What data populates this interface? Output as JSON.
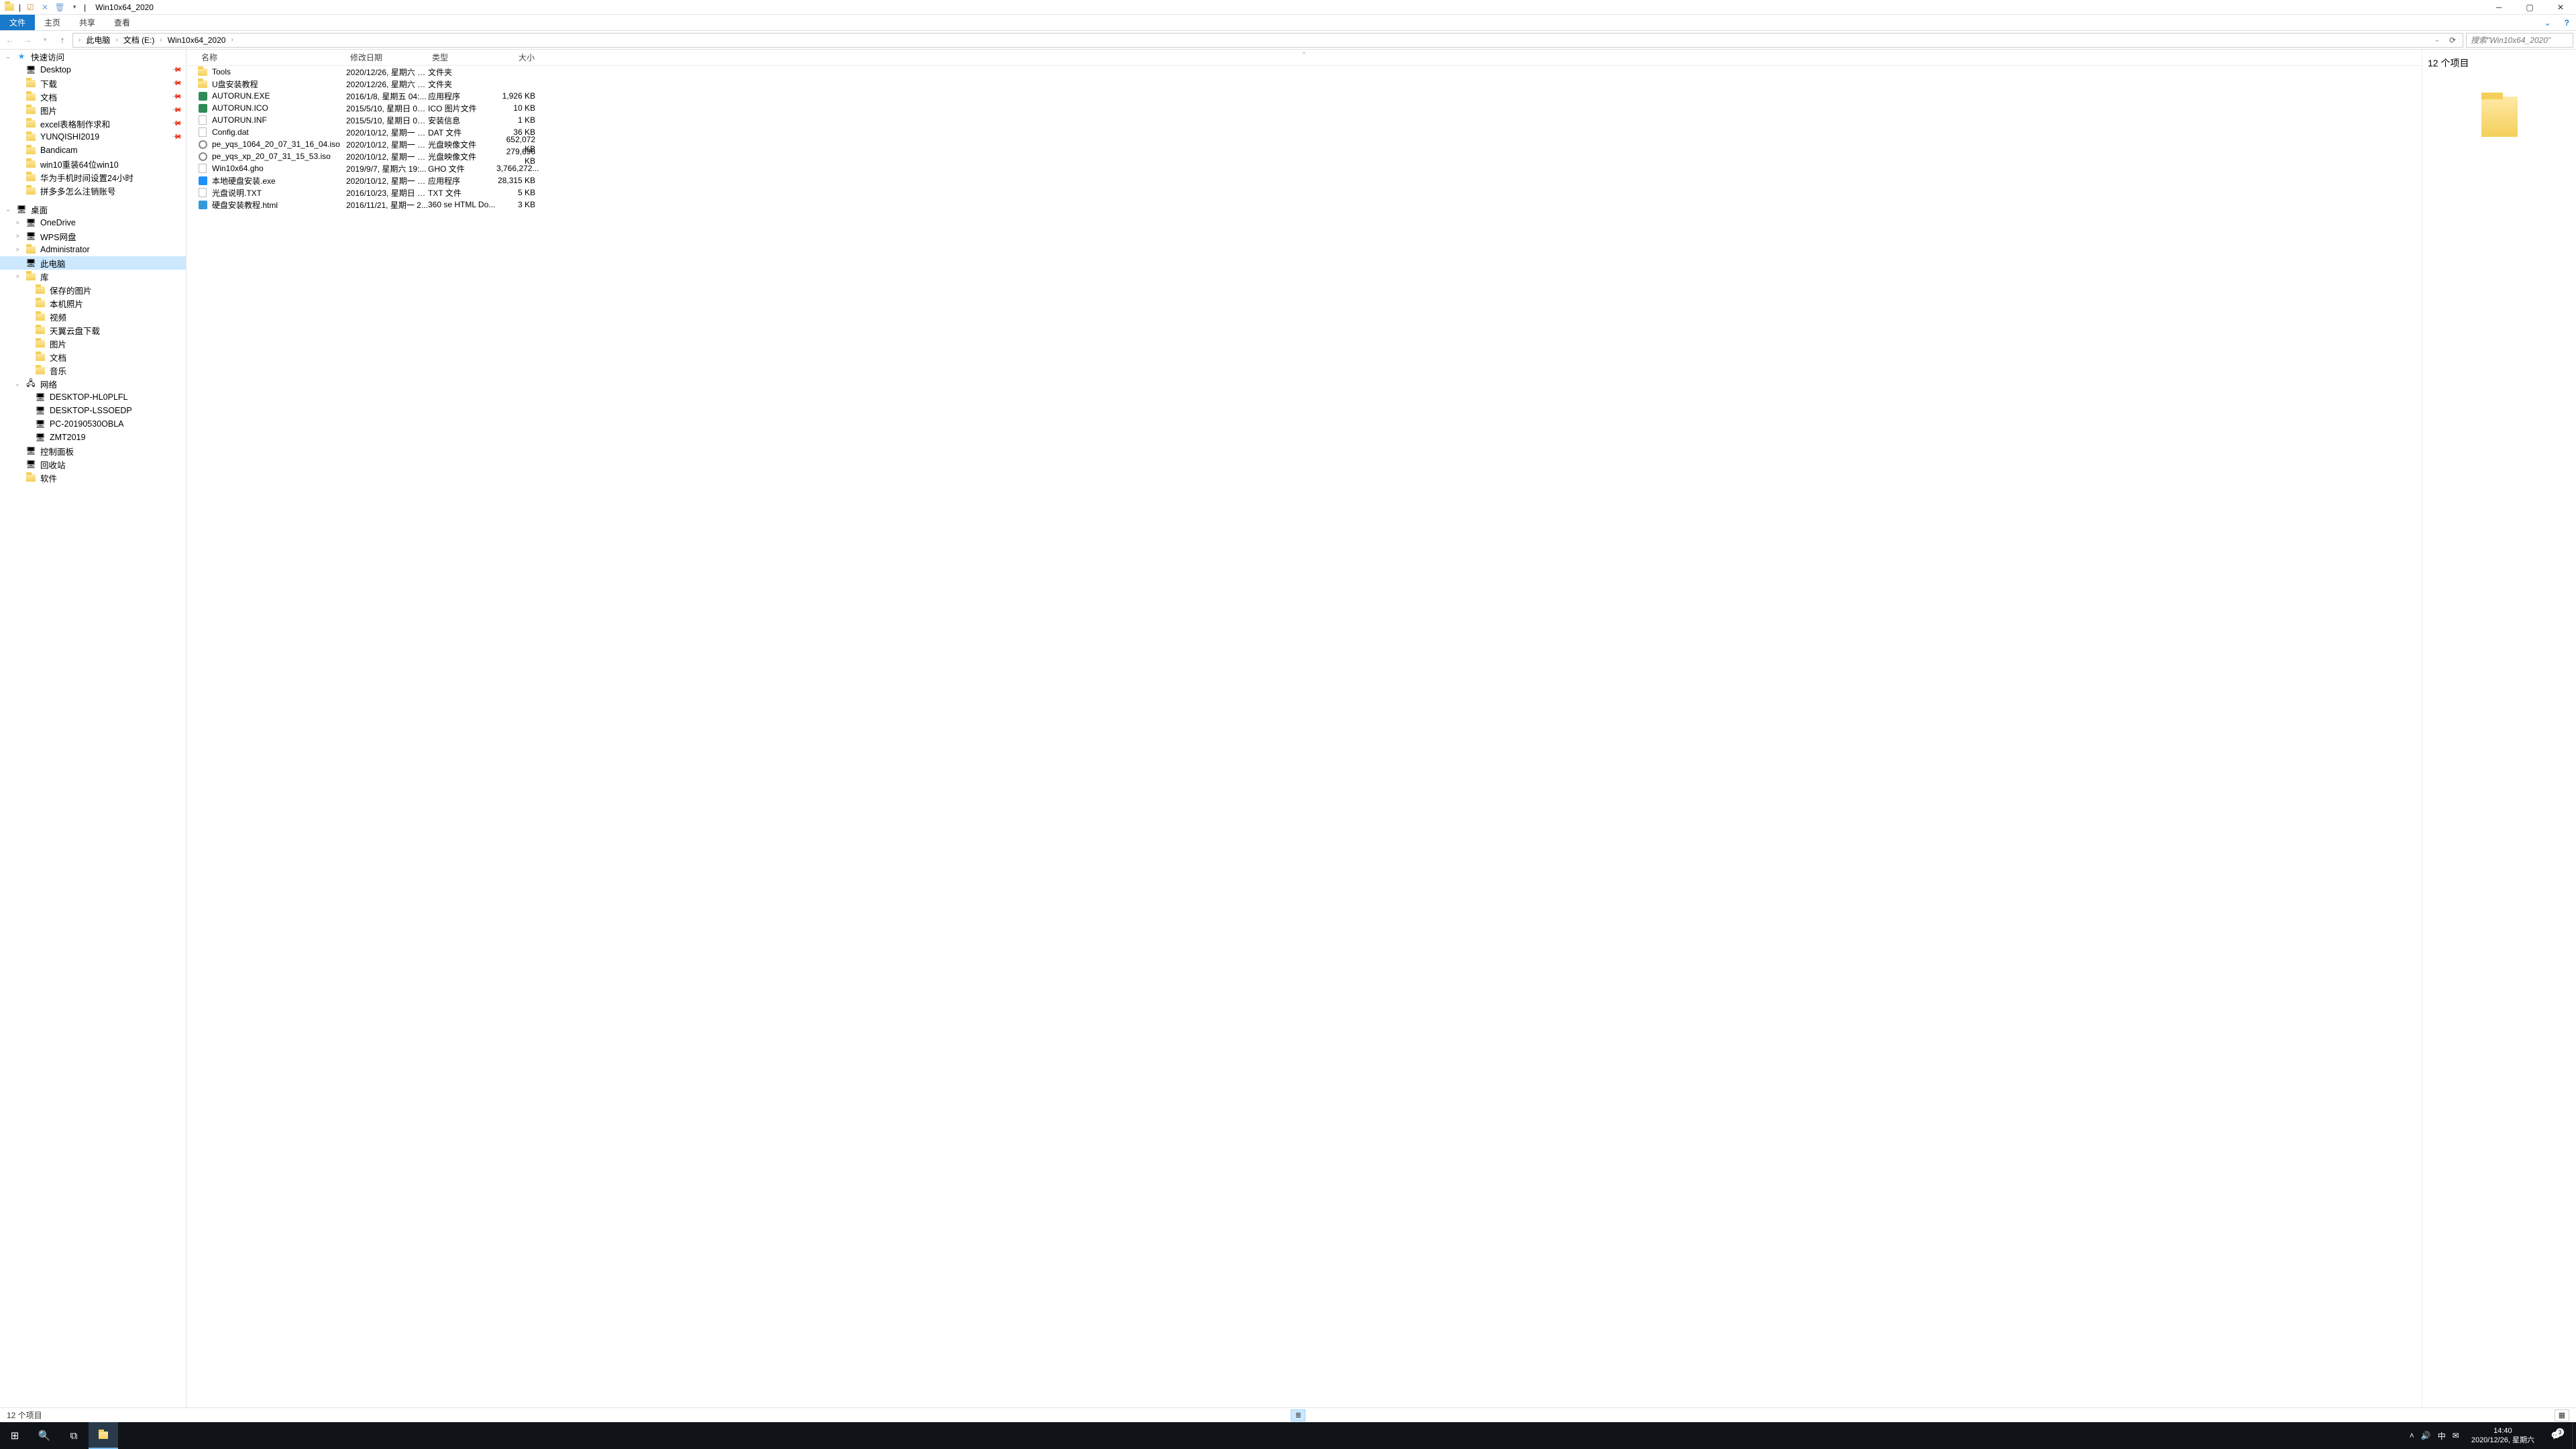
{
  "window": {
    "title": "Win10x64_2020",
    "qat_sep": "|"
  },
  "ribbon": {
    "file": "文件",
    "tabs": [
      "主页",
      "共享",
      "查看"
    ]
  },
  "address": {
    "crumbs": [
      "此电脑",
      "文档 (E:)",
      "Win10x64_2020"
    ],
    "search_placeholder": "搜索\"Win10x64_2020\""
  },
  "columns": {
    "name": "名称",
    "date": "修改日期",
    "type": "类型",
    "size": "大小"
  },
  "sidebar": {
    "quick_access": "快速访问",
    "items_quick": [
      {
        "label": "Desktop",
        "pin": true,
        "ic": "i-desk"
      },
      {
        "label": "下载",
        "pin": true,
        "ic": "i-folder"
      },
      {
        "label": "文档",
        "pin": true,
        "ic": "i-folder"
      },
      {
        "label": "图片",
        "pin": true,
        "ic": "i-folder"
      },
      {
        "label": "excel表格制作求和",
        "pin": true,
        "ic": "i-folder"
      },
      {
        "label": "YUNQISHI2019",
        "pin": true,
        "ic": "i-folder"
      },
      {
        "label": "Bandicam",
        "pin": false,
        "ic": "i-folder"
      },
      {
        "label": "win10重装64位win10",
        "pin": false,
        "ic": "i-folder"
      },
      {
        "label": "华为手机时间设置24小时",
        "pin": false,
        "ic": "i-folder"
      },
      {
        "label": "拼多多怎么注销账号",
        "pin": false,
        "ic": "i-folder"
      }
    ],
    "desktop": "桌面",
    "items_desktop": [
      {
        "label": "OneDrive",
        "ic": "i-desk"
      },
      {
        "label": "WPS网盘",
        "ic": "i-desk"
      },
      {
        "label": "Administrator",
        "ic": "i-folder"
      },
      {
        "label": "此电脑",
        "ic": "i-desk",
        "sel": true
      },
      {
        "label": "库",
        "ic": "i-folder"
      }
    ],
    "items_lib": [
      {
        "label": "保存的图片",
        "ic": "i-folder"
      },
      {
        "label": "本机照片",
        "ic": "i-folder"
      },
      {
        "label": "视频",
        "ic": "i-folder"
      },
      {
        "label": "天翼云盘下载",
        "ic": "i-folder"
      },
      {
        "label": "图片",
        "ic": "i-folder"
      },
      {
        "label": "文档",
        "ic": "i-folder"
      },
      {
        "label": "音乐",
        "ic": "i-folder"
      }
    ],
    "network": "网络",
    "items_net": [
      {
        "label": "DESKTOP-HL0PLFL",
        "ic": "i-drive"
      },
      {
        "label": "DESKTOP-LSSOEDP",
        "ic": "i-drive"
      },
      {
        "label": "PC-20190530OBLA",
        "ic": "i-drive"
      },
      {
        "label": "ZMT2019",
        "ic": "i-drive"
      }
    ],
    "items_tail": [
      {
        "label": "控制面板",
        "ic": "i-drive"
      },
      {
        "label": "回收站",
        "ic": "i-drive"
      },
      {
        "label": "软件",
        "ic": "i-folder"
      }
    ]
  },
  "files": [
    {
      "name": "Tools",
      "date": "2020/12/26, 星期六 1...",
      "type": "文件夹",
      "size": "",
      "ic": "i-folder"
    },
    {
      "name": "U盘安装教程",
      "date": "2020/12/26, 星期六 1...",
      "type": "文件夹",
      "size": "",
      "ic": "i-folder"
    },
    {
      "name": "AUTORUN.EXE",
      "date": "2016/1/8, 星期五 04:...",
      "type": "应用程序",
      "size": "1,926 KB",
      "ic": "i-exe"
    },
    {
      "name": "AUTORUN.ICO",
      "date": "2015/5/10, 星期日 02...",
      "type": "ICO 图片文件",
      "size": "10 KB",
      "ic": "i-exe"
    },
    {
      "name": "AUTORUN.INF",
      "date": "2015/5/10, 星期日 02...",
      "type": "安装信息",
      "size": "1 KB",
      "ic": "i-file"
    },
    {
      "name": "Config.dat",
      "date": "2020/10/12, 星期一 1...",
      "type": "DAT 文件",
      "size": "36 KB",
      "ic": "i-file"
    },
    {
      "name": "pe_yqs_1064_20_07_31_16_04.iso",
      "date": "2020/10/12, 星期一 1...",
      "type": "光盘映像文件",
      "size": "652,072 KB",
      "ic": "i-iso"
    },
    {
      "name": "pe_yqs_xp_20_07_31_15_53.iso",
      "date": "2020/10/12, 星期一 1...",
      "type": "光盘映像文件",
      "size": "279,696 KB",
      "ic": "i-iso"
    },
    {
      "name": "Win10x64.gho",
      "date": "2019/9/7, 星期六 19:...",
      "type": "GHO 文件",
      "size": "3,766,272...",
      "ic": "i-file"
    },
    {
      "name": "本地硬盘安装.exe",
      "date": "2020/10/12, 星期一 1...",
      "type": "应用程序",
      "size": "28,315 KB",
      "ic": "i-app"
    },
    {
      "name": "光盘说明.TXT",
      "date": "2016/10/23, 星期日 0...",
      "type": "TXT 文件",
      "size": "5 KB",
      "ic": "i-txt"
    },
    {
      "name": "硬盘安装教程.html",
      "date": "2016/11/21, 星期一 2...",
      "type": "360 se HTML Do...",
      "size": "3 KB",
      "ic": "i-html"
    }
  ],
  "preview": {
    "count": "12 个项目"
  },
  "status": {
    "text": "12 个项目"
  },
  "taskbar": {
    "time": "14:40",
    "date": "2020/12/26, 星期六",
    "ime": "中",
    "notif_count": "3"
  }
}
